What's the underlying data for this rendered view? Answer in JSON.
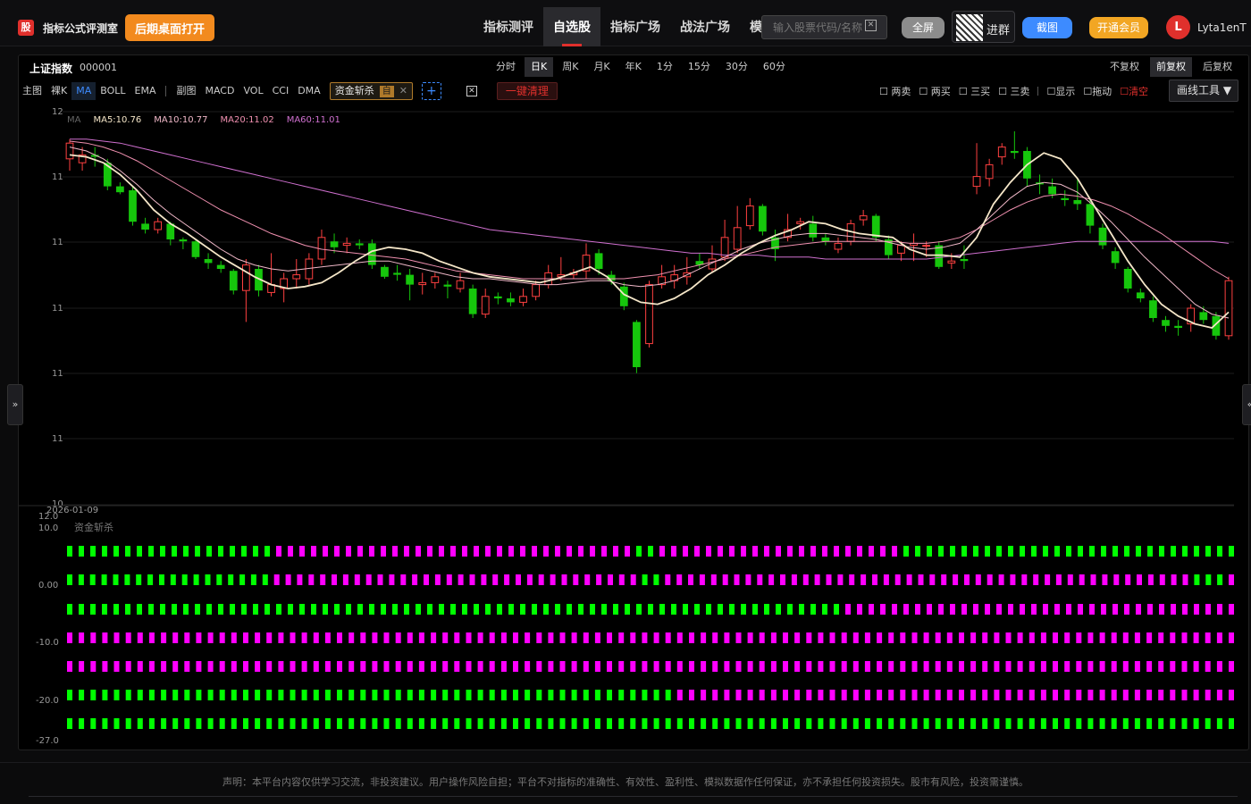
{
  "header": {
    "logo": "股",
    "title": "指标公式评测室",
    "open_desktop": "后期桌面打开",
    "nav": [
      "指标测评",
      "自选股",
      "指标广场",
      "战法广场",
      "模拟盘"
    ],
    "search_placeholder": "输入股票代码/名称",
    "fullscreen": "全屏",
    "group": "进群",
    "screenshot": "截图",
    "vip": "开通会员",
    "avatar": "L",
    "username": "Lyta1enT"
  },
  "symbol": {
    "name": "上证指数",
    "code": "000001"
  },
  "periods": [
    "分时",
    "日K",
    "周K",
    "月K",
    "年K",
    "1分",
    "15分",
    "30分",
    "60分"
  ],
  "active_period": "日K",
  "adjust": [
    "不复权",
    "前复权",
    "后复权"
  ],
  "active_adjust": "前复权",
  "toolbar": {
    "main_label": "主图",
    "main_items": [
      "裸K",
      "MA",
      "BOLL",
      "EMA"
    ],
    "sub_label": "副图",
    "sub_items": [
      "MACD",
      "VOL",
      "CCI",
      "DMA"
    ],
    "indicator_chip": "资金斩杀",
    "chip_badge": "自",
    "add": "+",
    "clear_all": "一键清理"
  },
  "draw_tools": [
    "两卖",
    "两买",
    "三买",
    "三卖",
    "显示",
    "拖动",
    "清空"
  ],
  "draw_tools_button": "画线工具",
  "ma_legend": [
    {
      "label": "MA",
      "color": "#666666"
    },
    {
      "label": "MA5:10.76",
      "color": "#f5e6c8"
    },
    {
      "label": "MA10:10.77",
      "color": "#f0b8c8"
    },
    {
      "label": "MA20:11.02",
      "color": "#f090b0"
    },
    {
      "label": "MA60:11.01",
      "color": "#d070d0"
    }
  ],
  "main_y_labels": [
    "12",
    "11",
    "11",
    "11",
    "11",
    "11",
    "10"
  ],
  "sub_y_labels": [
    "12.0",
    "10.0",
    "0.00",
    "-10.0",
    "-20.0",
    "-27.0"
  ],
  "date_label": "2026-01-09",
  "sub_title": "资金斩杀",
  "colors": {
    "up": "#ff4040",
    "down": "#16c60c",
    "magenta": "#ff00ff",
    "green_bar": "#00ff00",
    "accent": "#e0302c"
  },
  "disclaimer": "声明：本平台内容仅供学习交流，非投资建议。用户操作风险自担；平台不对指标的准确性、有效性、盈利性、模拟数据作任何保证，亦不承担任何投资损失。股市有风险，投资需谨慎。",
  "chart_data": {
    "type": "candlestick",
    "y_range": [
      10.0,
      12.0
    ],
    "candles": [
      {
        "o": 11.76,
        "c": 11.84,
        "h": 11.86,
        "l": 11.7
      },
      {
        "o": 11.74,
        "c": 11.78,
        "h": 11.82,
        "l": 11.7
      },
      {
        "o": 11.78,
        "c": 11.77,
        "h": 11.82,
        "l": 11.72
      },
      {
        "o": 11.74,
        "c": 11.62,
        "h": 11.76,
        "l": 11.6
      },
      {
        "o": 11.62,
        "c": 11.59,
        "h": 11.64,
        "l": 11.58
      },
      {
        "o": 11.6,
        "c": 11.44,
        "h": 11.62,
        "l": 11.42
      },
      {
        "o": 11.43,
        "c": 11.4,
        "h": 11.46,
        "l": 11.38
      },
      {
        "o": 11.4,
        "c": 11.44,
        "h": 11.46,
        "l": 11.38
      },
      {
        "o": 11.43,
        "c": 11.35,
        "h": 11.44,
        "l": 11.32
      },
      {
        "o": 11.35,
        "c": 11.34,
        "h": 11.36,
        "l": 11.3
      },
      {
        "o": 11.34,
        "c": 11.26,
        "h": 11.35,
        "l": 11.25
      },
      {
        "o": 11.25,
        "c": 11.23,
        "h": 11.28,
        "l": 11.2
      },
      {
        "o": 11.22,
        "c": 11.2,
        "h": 11.24,
        "l": 11.18
      },
      {
        "o": 11.19,
        "c": 11.09,
        "h": 11.2,
        "l": 11.07
      },
      {
        "o": 11.09,
        "c": 11.22,
        "h": 11.25,
        "l": 10.93
      },
      {
        "o": 11.2,
        "c": 11.09,
        "h": 11.22,
        "l": 11.06
      },
      {
        "o": 11.08,
        "c": 11.12,
        "h": 11.28,
        "l": 11.06
      },
      {
        "o": 11.1,
        "c": 11.15,
        "h": 11.18,
        "l": 11.03
      },
      {
        "o": 11.15,
        "c": 11.17,
        "h": 11.25,
        "l": 11.1
      },
      {
        "o": 11.15,
        "c": 11.25,
        "h": 11.28,
        "l": 11.12
      },
      {
        "o": 11.25,
        "c": 11.36,
        "h": 11.4,
        "l": 11.22
      },
      {
        "o": 11.34,
        "c": 11.31,
        "h": 11.38,
        "l": 11.28
      },
      {
        "o": 11.32,
        "c": 11.33,
        "h": 11.36,
        "l": 11.28
      },
      {
        "o": 11.33,
        "c": 11.32,
        "h": 11.35,
        "l": 11.3
      },
      {
        "o": 11.33,
        "c": 11.22,
        "h": 11.35,
        "l": 11.2
      },
      {
        "o": 11.21,
        "c": 11.16,
        "h": 11.22,
        "l": 11.15
      },
      {
        "o": 11.18,
        "c": 11.17,
        "h": 11.22,
        "l": 11.14
      },
      {
        "o": 11.17,
        "c": 11.12,
        "h": 11.2,
        "l": 11.04
      },
      {
        "o": 11.12,
        "c": 11.13,
        "h": 11.18,
        "l": 11.07
      },
      {
        "o": 11.13,
        "c": 11.16,
        "h": 11.18,
        "l": 11.1
      },
      {
        "o": 11.12,
        "c": 11.11,
        "h": 11.14,
        "l": 11.05
      },
      {
        "o": 11.1,
        "c": 11.14,
        "h": 11.18,
        "l": 11.08
      },
      {
        "o": 11.1,
        "c": 10.97,
        "h": 11.12,
        "l": 10.95
      },
      {
        "o": 10.97,
        "c": 11.06,
        "h": 11.1,
        "l": 10.95
      },
      {
        "o": 11.06,
        "c": 11.05,
        "h": 11.08,
        "l": 11.02
      },
      {
        "o": 11.05,
        "c": 11.03,
        "h": 11.08,
        "l": 11.01
      },
      {
        "o": 11.03,
        "c": 11.06,
        "h": 11.1,
        "l": 11.01
      },
      {
        "o": 11.06,
        "c": 11.12,
        "h": 11.14,
        "l": 11.04
      },
      {
        "o": 11.12,
        "c": 11.18,
        "h": 11.22,
        "l": 11.1
      },
      {
        "o": 11.16,
        "c": 11.17,
        "h": 11.26,
        "l": 11.14
      },
      {
        "o": 11.17,
        "c": 11.18,
        "h": 11.2,
        "l": 11.15
      },
      {
        "o": 11.19,
        "c": 11.27,
        "h": 11.33,
        "l": 11.15
      },
      {
        "o": 11.28,
        "c": 11.2,
        "h": 11.3,
        "l": 11.17
      },
      {
        "o": 11.17,
        "c": 11.14,
        "h": 11.19,
        "l": 11.12
      },
      {
        "o": 11.11,
        "c": 11.01,
        "h": 11.13,
        "l": 10.99
      },
      {
        "o": 10.93,
        "c": 10.7,
        "h": 10.94,
        "l": 10.67
      },
      {
        "o": 10.82,
        "c": 11.12,
        "h": 11.14,
        "l": 10.8
      },
      {
        "o": 11.12,
        "c": 11.16,
        "h": 11.22,
        "l": 11.1
      },
      {
        "o": 11.14,
        "c": 11.17,
        "h": 11.22,
        "l": 11.1
      },
      {
        "o": 11.16,
        "c": 11.18,
        "h": 11.26,
        "l": 11.12
      },
      {
        "o": 11.24,
        "c": 11.22,
        "h": 11.28,
        "l": 11.2
      },
      {
        "o": 11.2,
        "c": 11.25,
        "h": 11.32,
        "l": 11.18
      },
      {
        "o": 11.26,
        "c": 11.36,
        "h": 11.45,
        "l": 11.24
      },
      {
        "o": 11.3,
        "c": 11.41,
        "h": 11.52,
        "l": 11.28
      },
      {
        "o": 11.42,
        "c": 11.52,
        "h": 11.56,
        "l": 11.4
      },
      {
        "o": 11.52,
        "c": 11.39,
        "h": 11.53,
        "l": 11.37
      },
      {
        "o": 11.36,
        "c": 11.3,
        "h": 11.4,
        "l": 11.24
      },
      {
        "o": 11.36,
        "c": 11.4,
        "h": 11.48,
        "l": 11.34
      },
      {
        "o": 11.43,
        "c": 11.44,
        "h": 11.46,
        "l": 11.4
      },
      {
        "o": 11.43,
        "c": 11.36,
        "h": 11.47,
        "l": 11.34
      },
      {
        "o": 11.36,
        "c": 11.34,
        "h": 11.38,
        "l": 11.32
      },
      {
        "o": 11.3,
        "c": 11.33,
        "h": 11.36,
        "l": 11.28
      },
      {
        "o": 11.34,
        "c": 11.43,
        "h": 11.45,
        "l": 11.32
      },
      {
        "o": 11.45,
        "c": 11.47,
        "h": 11.5,
        "l": 11.42
      },
      {
        "o": 11.47,
        "c": 11.36,
        "h": 11.48,
        "l": 11.34
      },
      {
        "o": 11.35,
        "c": 11.27,
        "h": 11.37,
        "l": 11.25
      },
      {
        "o": 11.28,
        "c": 11.32,
        "h": 11.34,
        "l": 11.24
      },
      {
        "o": 11.32,
        "c": 11.33,
        "h": 11.38,
        "l": 11.24
      },
      {
        "o": 11.32,
        "c": 11.32,
        "h": 11.34,
        "l": 11.26
      },
      {
        "o": 11.32,
        "c": 11.21,
        "h": 11.34,
        "l": 11.2
      },
      {
        "o": 11.23,
        "c": 11.24,
        "h": 11.28,
        "l": 11.2
      },
      {
        "o": 11.25,
        "c": 11.24,
        "h": 11.32,
        "l": 11.2
      },
      {
        "o": 11.62,
        "c": 11.67,
        "h": 11.84,
        "l": 11.58
      },
      {
        "o": 11.66,
        "c": 11.73,
        "h": 11.76,
        "l": 11.62
      },
      {
        "o": 11.77,
        "c": 11.82,
        "h": 11.84,
        "l": 11.73
      },
      {
        "o": 11.8,
        "c": 11.79,
        "h": 11.9,
        "l": 11.76
      },
      {
        "o": 11.8,
        "c": 11.66,
        "h": 11.82,
        "l": 11.62
      },
      {
        "o": 11.64,
        "c": 11.63,
        "h": 11.68,
        "l": 11.58
      },
      {
        "o": 11.62,
        "c": 11.58,
        "h": 11.66,
        "l": 11.56
      },
      {
        "o": 11.56,
        "c": 11.55,
        "h": 11.6,
        "l": 11.52
      },
      {
        "o": 11.55,
        "c": 11.53,
        "h": 11.66,
        "l": 11.5
      },
      {
        "o": 11.53,
        "c": 11.42,
        "h": 11.56,
        "l": 11.38
      },
      {
        "o": 11.41,
        "c": 11.32,
        "h": 11.43,
        "l": 11.3
      },
      {
        "o": 11.29,
        "c": 11.23,
        "h": 11.31,
        "l": 11.2
      },
      {
        "o": 11.2,
        "c": 11.1,
        "h": 11.21,
        "l": 11.08
      },
      {
        "o": 11.08,
        "c": 11.05,
        "h": 11.1,
        "l": 11.03
      },
      {
        "o": 11.04,
        "c": 10.95,
        "h": 11.06,
        "l": 10.93
      },
      {
        "o": 10.94,
        "c": 10.91,
        "h": 10.96,
        "l": 10.88
      },
      {
        "o": 10.91,
        "c": 10.9,
        "h": 10.94,
        "l": 10.86
      },
      {
        "o": 10.92,
        "c": 11.0,
        "h": 11.02,
        "l": 10.88
      },
      {
        "o": 10.98,
        "c": 10.94,
        "h": 11.01,
        "l": 10.92
      },
      {
        "o": 10.96,
        "c": 10.86,
        "h": 10.98,
        "l": 10.84
      },
      {
        "o": 10.86,
        "c": 11.14,
        "h": 11.16,
        "l": 10.84
      }
    ],
    "ma5": [
      11.78,
      11.77,
      11.74,
      11.68,
      11.6,
      11.5,
      11.43,
      11.38,
      11.32,
      11.26,
      11.21,
      11.16,
      11.12,
      11.1,
      11.11,
      11.13,
      11.18,
      11.24,
      11.29,
      11.31,
      11.3,
      11.28,
      11.24,
      11.21,
      11.18,
      11.16,
      11.15,
      11.14,
      11.13,
      11.15,
      11.18,
      11.21,
      11.16,
      11.07,
      11.03,
      11.02,
      11.05,
      11.1,
      11.17,
      11.22,
      11.28,
      11.33,
      11.37,
      11.4,
      11.44,
      11.43,
      11.4,
      11.38,
      11.37,
      11.36,
      11.3,
      11.27,
      11.27,
      11.26,
      11.36,
      11.53,
      11.64,
      11.73,
      11.79,
      11.76,
      11.66,
      11.52,
      11.38,
      11.24,
      11.12,
      11.02,
      10.96,
      10.92,
      10.9,
      10.98
    ],
    "ma10": [
      11.82,
      11.8,
      11.76,
      11.7,
      11.63,
      11.55,
      11.48,
      11.42,
      11.36,
      11.3,
      11.25,
      11.22,
      11.2,
      11.19,
      11.2,
      11.21,
      11.22,
      11.23,
      11.24,
      11.24,
      11.22,
      11.2,
      11.18,
      11.16,
      11.15,
      11.15,
      11.14,
      11.13,
      11.12,
      11.12,
      11.13,
      11.14,
      11.14,
      11.12,
      11.11,
      11.12,
      11.14,
      11.18,
      11.22,
      11.26,
      11.3,
      11.33,
      11.35,
      11.37,
      11.38,
      11.38,
      11.37,
      11.36,
      11.35,
      11.33,
      11.31,
      11.3,
      11.31,
      11.33,
      11.4,
      11.48,
      11.56,
      11.62,
      11.64,
      11.63,
      11.59,
      11.52,
      11.44,
      11.35,
      11.26,
      11.18,
      11.1,
      11.02,
      10.97,
      10.95
    ],
    "ma20": [
      11.85,
      11.84,
      11.82,
      11.79,
      11.75,
      11.7,
      11.65,
      11.6,
      11.55,
      11.5,
      11.46,
      11.42,
      11.38,
      11.35,
      11.32,
      11.3,
      11.29,
      11.28,
      11.27,
      11.26,
      11.25,
      11.23,
      11.21,
      11.19,
      11.18,
      11.17,
      11.16,
      11.15,
      11.15,
      11.15,
      11.15,
      11.15,
      11.15,
      11.15,
      11.16,
      11.17,
      11.19,
      11.21,
      11.23,
      11.25,
      11.27,
      11.29,
      11.31,
      11.32,
      11.33,
      11.34,
      11.34,
      11.34,
      11.34,
      11.34,
      11.33,
      11.33,
      11.34,
      11.36,
      11.4,
      11.45,
      11.5,
      11.54,
      11.57,
      11.58,
      11.57,
      11.55,
      11.52,
      11.48,
      11.43,
      11.38,
      11.32,
      11.26,
      11.2,
      11.15
    ],
    "ma60": [
      11.86,
      11.86,
      11.85,
      11.84,
      11.82,
      11.8,
      11.78,
      11.76,
      11.74,
      11.72,
      11.7,
      11.68,
      11.66,
      11.64,
      11.62,
      11.6,
      11.58,
      11.56,
      11.54,
      11.52,
      11.5,
      11.48,
      11.46,
      11.44,
      11.42,
      11.4,
      11.39,
      11.38,
      11.37,
      11.36,
      11.35,
      11.34,
      11.33,
      11.32,
      11.31,
      11.3,
      11.29,
      11.28,
      11.28,
      11.27,
      11.27,
      11.27,
      11.26,
      11.26,
      11.26,
      11.25,
      11.25,
      11.25,
      11.25,
      11.25,
      11.25,
      11.25,
      11.26,
      11.27,
      11.28,
      11.29,
      11.3,
      11.31,
      11.32,
      11.33,
      11.34,
      11.34,
      11.34,
      11.34,
      11.34,
      11.34,
      11.34,
      11.34,
      11.34,
      11.33
    ],
    "sub_rows": [
      {
        "pattern": "GGGGGGGGGGGGGGGGGGMMMMMMMMMMMMMMMMMMMMMMMMMMMMMMMGGMMMMMMMMMMMMMMMMMMMMMGGGGGGGGGGGGGGGGGGGGGGGGGGGGG"
      },
      {
        "pattern": "GGGGGGGGGGGGGGGGGGMMMMMMMMMMMMMMMMMMMMMMMMMMMMMMMMGGMMMMMMMMMMMMMMMMMMMMMMMMMMMMMMMMMMMMMMMMMMMMMMGGGM"
      },
      {
        "pattern": "GGGGGGGGGGGGGGGGGGGGGGGGGGGGGGGGGGGGGGGGGGGGGGGGGGGGGGGGGGGGGGGGGGGMMMMMMMMMMMMMMMMMMMMMMMMMMMMMMMMMM"
      },
      {
        "pattern": "MMMMMMMMMMMMMMMMMMMMMMMMMMMMMMMMMMMMMMMMMMMMMMMMMMMMMMMMMMMMMMMMMMMMMMMMMMMMMMMMMMMMMMMMMMMMMMMMMMMM"
      },
      {
        "pattern": "MMMMMMMMMMMMMMMMMMMMMMMMMMMMMMMMMMMMMMMMMMMMMMMMMMMMMMMMMMMMMMMMMMMMMMMMMMMMMMMMMMMMMMMMMMMMMMMMMMMM"
      },
      {
        "pattern": "GGGGGGGGGGGGGGGGGGGGGGGGGGGGGGGGGGGGGGGGGGGGGGGGGGGGMMMMMMMMMMMMMMMMMMMMMMMMMMMMMMMMMMMMMMMMMMMMMMMM"
      },
      {
        "pattern": "GGGGGGGGGGGGGGGGGGGGGGGGGGGGGGGGGGGGGGGGGGGGGGGGGGGGGGGGGGGGGGGGGGGGGGGGGGGGGGGGGGGGGGGGGGGGGGGGGGGG"
      }
    ]
  }
}
